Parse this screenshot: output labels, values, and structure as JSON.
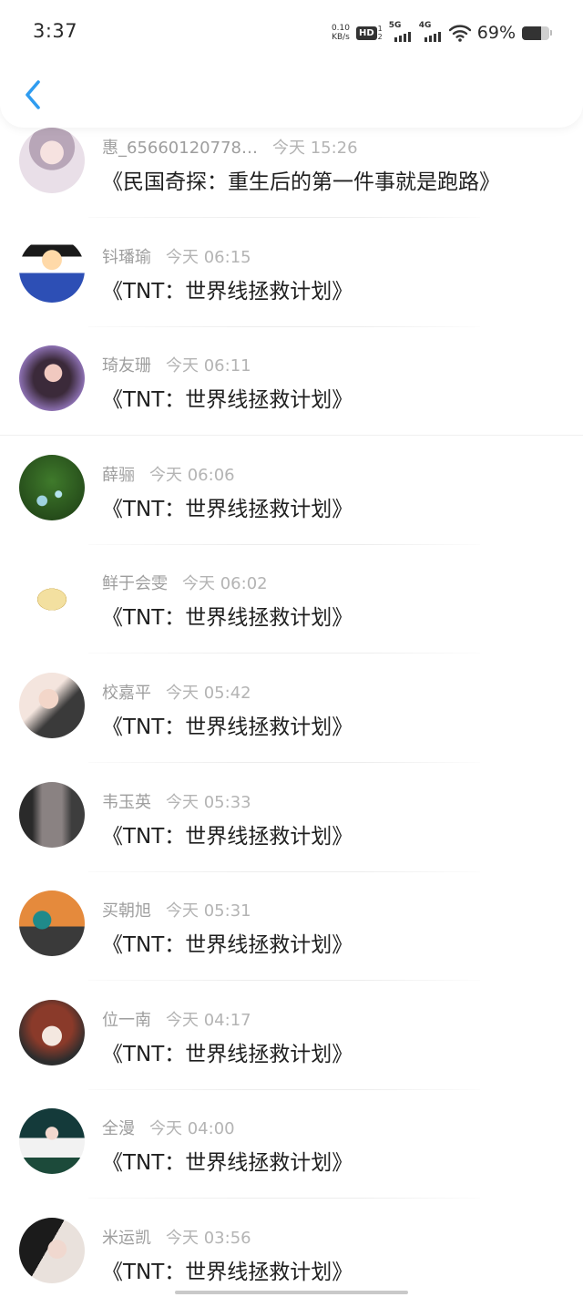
{
  "status_bar": {
    "time": "3:37",
    "net_speed_value": "0.10",
    "net_speed_unit": "KB/s",
    "hd_label": "HD",
    "hd_sub_top": "1",
    "hd_sub_bottom": "2",
    "signal_5g_label": "5G",
    "signal_4g_label": "4G",
    "battery_percent": "69%",
    "battery_level": 0.69
  },
  "nav": {
    "back_icon": "chevron-left-icon",
    "accent_color": "#2f9cf0"
  },
  "items": [
    {
      "name": "惠_65660120778…",
      "time": "今天 15:26",
      "title": "《民国奇探：重生后的第一件事就是跑路》"
    },
    {
      "name": "钭璠瑜",
      "time": "今天 06:15",
      "title": "《TNT：世界线拯救计划》"
    },
    {
      "name": "琦友珊",
      "time": "今天 06:11",
      "title": "《TNT：世界线拯救计划》"
    },
    {
      "name": "薛骊",
      "time": "今天 06:06",
      "title": "《TNT：世界线拯救计划》"
    },
    {
      "name": "鲜于会雯",
      "time": "今天 06:02",
      "title": "《TNT：世界线拯救计划》"
    },
    {
      "name": "校嘉平",
      "time": "今天 05:42",
      "title": "《TNT：世界线拯救计划》"
    },
    {
      "name": "韦玉英",
      "time": "今天 05:33",
      "title": "《TNT：世界线拯救计划》"
    },
    {
      "name": "买朝旭",
      "time": "今天 05:31",
      "title": "《TNT：世界线拯救计划》"
    },
    {
      "name": "位一南",
      "time": "今天 04:17",
      "title": "《TNT：世界线拯救计划》"
    },
    {
      "name": "全漫",
      "time": "今天 04:00",
      "title": "《TNT：世界线拯救计划》"
    },
    {
      "name": "米运凯",
      "time": "今天 03:56",
      "title": "《TNT：世界线拯救计划》"
    }
  ]
}
